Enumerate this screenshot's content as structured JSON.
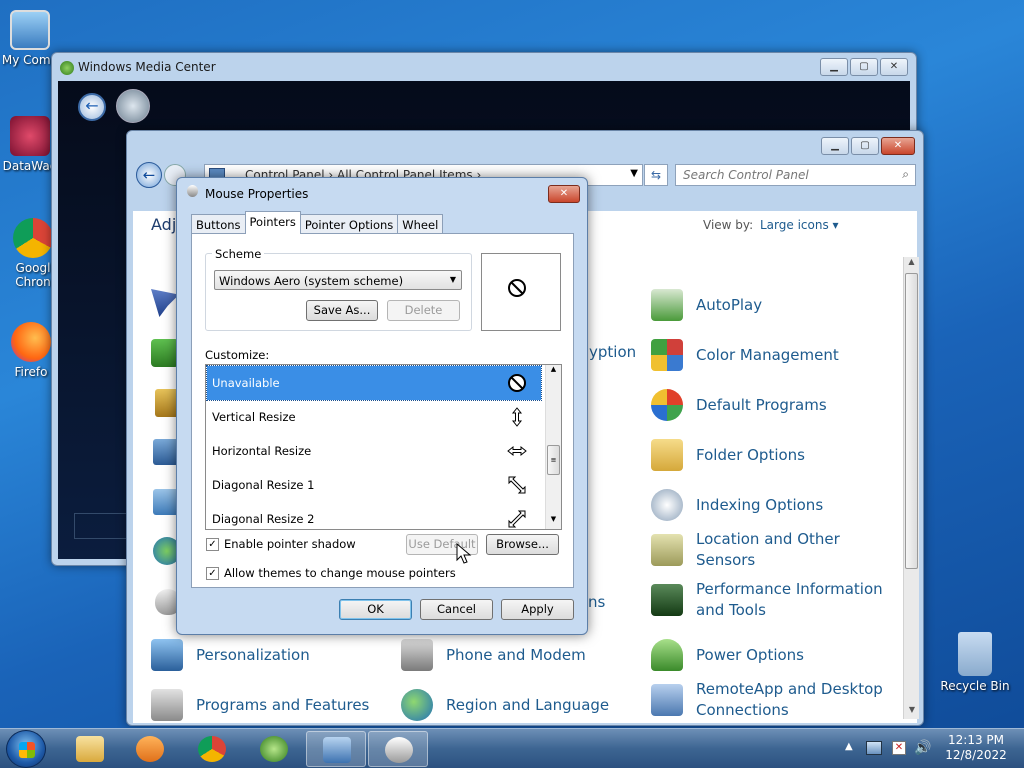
{
  "desktop": {
    "icons": [
      {
        "label": "My Comp"
      },
      {
        "label": "DataWag"
      },
      {
        "label": "Googl Chron"
      },
      {
        "label": "Firefo"
      },
      {
        "label": "Recycle Bin"
      }
    ]
  },
  "media_center": {
    "title": "Windows Media Center"
  },
  "control_panel": {
    "address": "Control Panel  ›  All Control Panel Items  ›",
    "search_placeholder": "Search Control Panel",
    "heading": "Adj",
    "view_by_label": "View by:",
    "view_by_value": "Large icons ▾",
    "col2_partial": [
      "yption",
      "ns"
    ],
    "col3_items": [
      {
        "label": "AutoPlay",
        "color": "#4a9a3a"
      },
      {
        "label": "Color Management",
        "color": "#d0403a"
      },
      {
        "label": "Default Programs",
        "color": "#3fa34d"
      },
      {
        "label": "Folder Options",
        "color": "#e8c35a"
      },
      {
        "label": "Indexing Options",
        "color": "#8aa0b8"
      },
      {
        "label": "Location and Other Sensors",
        "color": "#9c9a5a"
      },
      {
        "label": "Performance Information and Tools",
        "color": "#3a6a3a"
      },
      {
        "label": "Power Options",
        "color": "#58a83a"
      },
      {
        "label": "RemoteApp and Desktop Connections",
        "color": "#4b78b0"
      }
    ],
    "bottom_items": [
      {
        "label": "Personalization"
      },
      {
        "label": "Phone and Modem"
      },
      {
        "label": "Programs and Features"
      },
      {
        "label": "Region and Language"
      }
    ]
  },
  "dialog": {
    "title": "Mouse Properties",
    "tabs": [
      "Buttons",
      "Pointers",
      "Pointer Options",
      "Wheel"
    ],
    "active_tab": "Pointers",
    "scheme_label": "Scheme",
    "scheme_value": "Windows Aero (system scheme)",
    "save_as": "Save As...",
    "delete": "Delete",
    "customize_label": "Customize:",
    "pointers": [
      {
        "name": "Unavailable",
        "selected": true
      },
      {
        "name": "Vertical Resize",
        "selected": false
      },
      {
        "name": "Horizontal Resize",
        "selected": false
      },
      {
        "name": "Diagonal Resize 1",
        "selected": false
      },
      {
        "name": "Diagonal Resize 2",
        "selected": false
      }
    ],
    "enable_shadow": "Enable pointer shadow",
    "allow_themes": "Allow themes to change mouse pointers",
    "use_default": "Use Default",
    "browse": "Browse...",
    "ok": "OK",
    "cancel": "Cancel",
    "apply": "Apply"
  },
  "taskbar": {
    "time": "12:13 PM",
    "date": "12/8/2022"
  }
}
